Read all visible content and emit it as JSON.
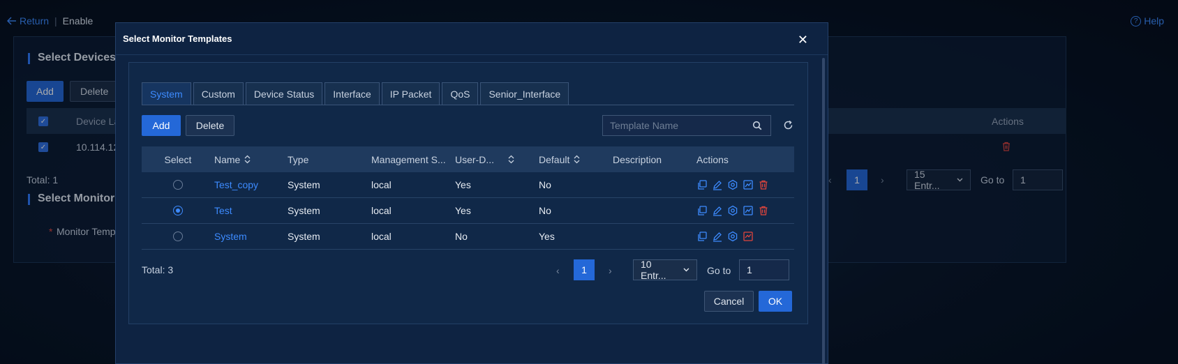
{
  "topbar": {
    "return_label": "Return",
    "crumb": "Enable",
    "help_label": "Help"
  },
  "background": {
    "section1_title": "Select Devices",
    "add_label": "Add",
    "delete_label": "Delete",
    "col_device_label": "Device La",
    "col_actions": "Actions",
    "row_ip": "10.114.12",
    "total": "Total: 1",
    "section2_title": "Select Monitor",
    "monitor_field_label": "Monitor Temp",
    "required_mark": "*",
    "page_num": "1",
    "page_size": "15 Entr...",
    "goto_label": "Go to",
    "goto_value": "1"
  },
  "modal": {
    "title": "Select Monitor Templates",
    "tabs": [
      {
        "label": "System",
        "active": true
      },
      {
        "label": "Custom"
      },
      {
        "label": "Device Status"
      },
      {
        "label": "Interface"
      },
      {
        "label": "IP Packet"
      },
      {
        "label": "QoS"
      },
      {
        "label": "Senior_Interface"
      }
    ],
    "add_label": "Add",
    "delete_label": "Delete",
    "search_placeholder": "Template Name",
    "columns": {
      "select": "Select",
      "name": "Name",
      "type": "Type",
      "mgmt": "Management S...",
      "user": "User-D...",
      "default": "Default",
      "description": "Description",
      "actions": "Actions"
    },
    "rows": [
      {
        "name": "Test_copy",
        "type": "System",
        "mgmt": "local",
        "user": "Yes",
        "default": "No",
        "description": "",
        "selected": false
      },
      {
        "name": "Test",
        "type": "System",
        "mgmt": "local",
        "user": "Yes",
        "default": "No",
        "description": "",
        "selected": true
      },
      {
        "name": "System",
        "type": "System",
        "mgmt": "local",
        "user": "No",
        "default": "Yes",
        "description": "",
        "selected": false
      }
    ],
    "total": "Total: 3",
    "page_num": "1",
    "page_size": "10 Entr...",
    "goto_label": "Go to",
    "goto_value": "1",
    "cancel_label": "Cancel",
    "ok_label": "OK"
  },
  "colors": {
    "accent": "#2468d8",
    "link": "#3d8bff",
    "danger": "#e0443c"
  }
}
